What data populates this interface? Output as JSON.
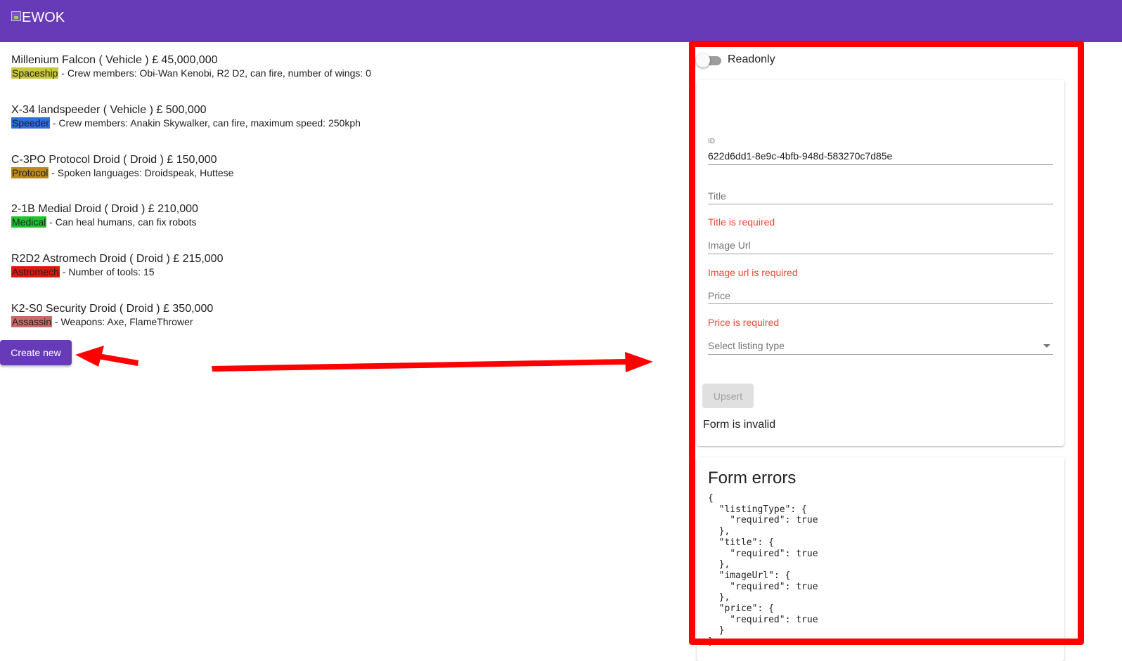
{
  "header": {
    "logo_alt": "EWOK",
    "background": "#673ab7"
  },
  "listings": [
    {
      "title": "Millenium Falcon ( Vehicle ) £ 45,000,000",
      "tag": "Spaceship",
      "tag_color": "#c8c83a",
      "details": " - Crew members: Obi-Wan Kenobi, R2 D2, can fire, number of wings: 0"
    },
    {
      "title": "X-34 landspeeder ( Vehicle ) £ 500,000",
      "tag": "Speeder",
      "tag_color": "#2d6fdc",
      "details": " - Crew members: Anakin Skywalker, can fire, maximum speed: 250kph"
    },
    {
      "title": "C-3PO Protocol Droid ( Droid ) £ 150,000",
      "tag": "Protocol",
      "tag_color": "#bb8a1c",
      "details": " - Spoken languages: Droidspeak, Huttese"
    },
    {
      "title": "2-1B Medial Droid ( Droid ) £ 210,000",
      "tag": "Medical",
      "tag_color": "#1fc132",
      "details": " - Can heal humans, can fix robots"
    },
    {
      "title": "R2D2 Astromech Droid ( Droid ) £ 215,000",
      "tag": "Astromech",
      "tag_color": "#e3160f",
      "details": " - Number of tools: 15"
    },
    {
      "title": "K2-S0 Security Droid ( Droid ) £ 350,000",
      "tag": "Assassin",
      "tag_color": "#c76a6a",
      "details": " - Weapons: Axe, FlameThrower"
    }
  ],
  "actions": {
    "create_label": "Create new"
  },
  "readonly": {
    "label": "Readonly",
    "checked": false
  },
  "form": {
    "id_label": "ID",
    "id_value": "622d6dd1-8e9c-4bfb-948d-583270c7d85e",
    "title_placeholder": "Title",
    "title_error": "Title is required",
    "image_placeholder": "Image Url",
    "image_error": "Image url is required",
    "price_placeholder": "Price",
    "price_error": "Price is required",
    "listing_type_placeholder": "Select listing type",
    "upsert_label": "Upsert",
    "status": "Form is invalid"
  },
  "errors": {
    "title": "Form errors",
    "json": "{\n  \"listingType\": {\n    \"required\": true\n  },\n  \"title\": {\n    \"required\": true\n  },\n  \"imageUrl\": {\n    \"required\": true\n  },\n  \"price\": {\n    \"required\": true\n  }\n}"
  },
  "annotation_color": "#ff0000"
}
